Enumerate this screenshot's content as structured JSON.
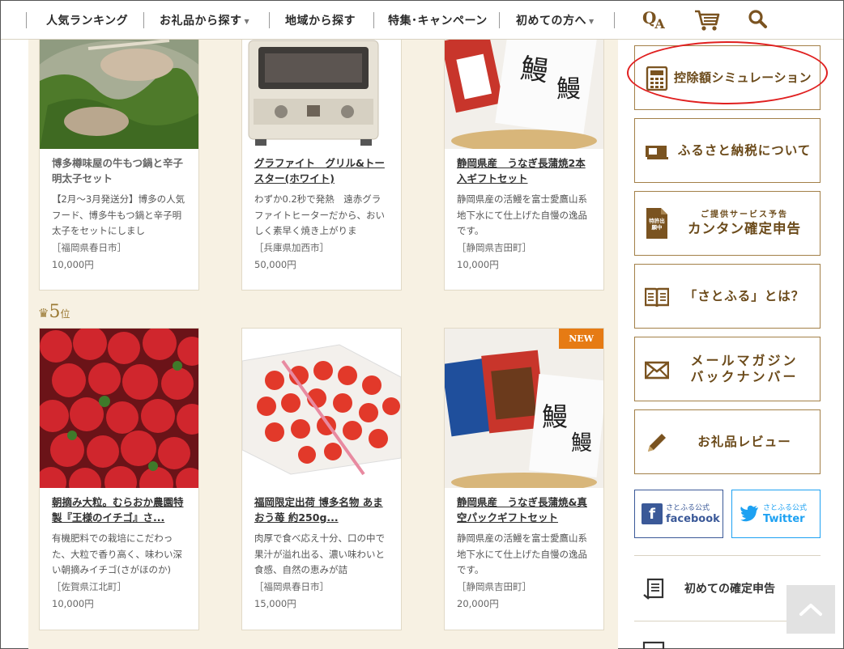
{
  "nav": {
    "ranking": "人気ランキング",
    "by_gift": "お礼品から探す",
    "by_region": "地域から探す",
    "campaign": "特集･キャンペーン",
    "first_time": "初めての方へ",
    "qa": "QA"
  },
  "rank5": {
    "num": "5",
    "unit": "位"
  },
  "cards": [
    {
      "title": "博多樽味屋の牛もつ鍋と辛子明太子セット",
      "desc": "【2月～3月発送分】博多の人気フード、博多牛もつ鍋と辛子明太子をセットにしまし",
      "region": "［福岡県春日市］",
      "price": "10,000円"
    },
    {
      "title": "グラファイト　グリル&トースター(ホワイト)",
      "desc": "わずか0.2秒で発熱　遠赤グラファイトヒーターだから、おいしく素早く焼き上がりま",
      "region": "［兵庫県加西市］",
      "price": "50,000円"
    },
    {
      "title": "静岡県産　うなぎ長蒲焼2本入ギフトセット",
      "desc": "静岡県産の活鰻を富士愛鷹山系地下水にて仕上げた自慢の逸品です。",
      "region": "［静岡県吉田町］",
      "price": "10,000円"
    },
    {
      "title": "朝摘み大粒。むらおか農園特製『王様のイチゴ』さ...",
      "desc": "有機肥料での栽培にこだわった、大粒で香り高く、味わい深い朝摘みイチゴ(さがほのか)",
      "region": "［佐賀県江北町］",
      "price": "10,000円"
    },
    {
      "title": "福岡限定出荷 博多名物 あまおう苺 約250g...",
      "desc": "肉厚で食べ応え十分、口の中で果汁が溢れ出る、濃い味わいと食感、自然の恵みが詰",
      "region": "［福岡県春日市］",
      "price": "15,000円"
    },
    {
      "title": "静岡県産　うなぎ長蒲焼&真空パックギフトセット",
      "desc": "静岡県産の活鰻を富士愛鷹山系地下水にて仕上げた自慢の逸品です。",
      "region": "［静岡県吉田町］",
      "price": "20,000円",
      "badge": "NEW"
    }
  ],
  "sidebar": {
    "simulation": "控除額シミュレーション",
    "about_furusato": "ふるさと納税について",
    "service_note": "ご提供サービス予告",
    "kakutei": "カンタン確定申告",
    "about_satofull": "「さとふる」とは？",
    "mail_line1": "メールマガジン",
    "mail_line2": "バックナンバー",
    "review": "お礼品レビュー",
    "fb_small": "さとふる公式",
    "fb_large": "facebook",
    "tw_small": "さとふる公式",
    "tw_large": "Twitter",
    "first_kakutei": "初めての確定申告",
    "patent_badge": "特許出願中"
  }
}
